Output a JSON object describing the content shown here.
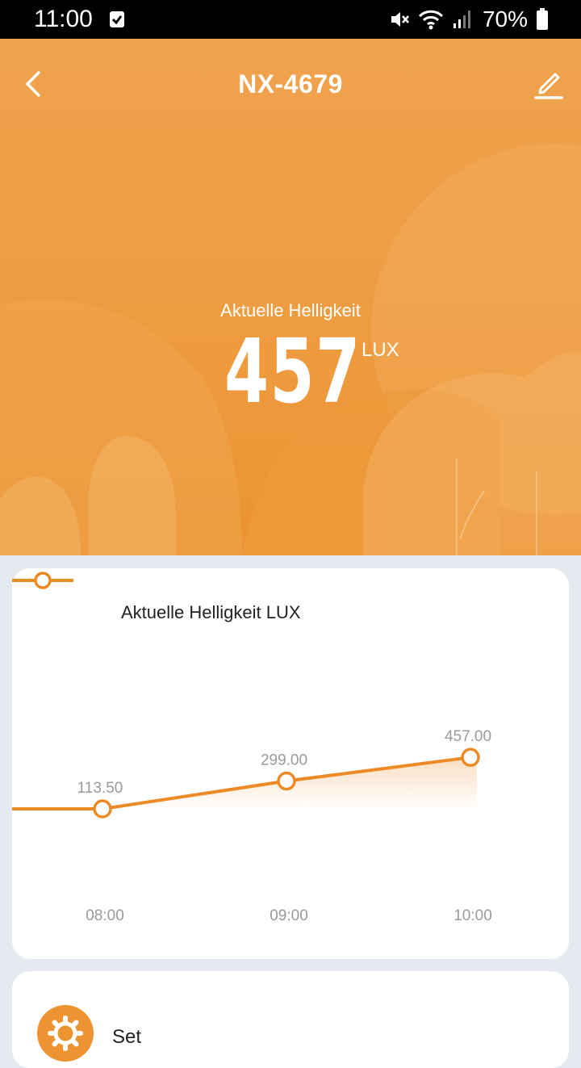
{
  "status_bar": {
    "time": "11:00",
    "battery": "70%"
  },
  "header": {
    "title": "NX-4679",
    "back_icon": "chevron-left-icon",
    "edit_icon": "pencil-icon"
  },
  "reading": {
    "label": "Aktuelle Helligkeit",
    "value": "457",
    "unit": "LUX"
  },
  "chart_data": {
    "type": "line",
    "legend": "Aktuelle Helligkeit LUX",
    "categories": [
      "08:00",
      "09:00",
      "10:00"
    ],
    "series": [
      {
        "name": "Aktuelle Helligkeit LUX",
        "values": [
          113.5,
          299.0,
          457.0
        ],
        "labels": [
          "113.50",
          "299.00",
          "457.00"
        ]
      }
    ],
    "color": "#ec8a26",
    "ylim": [
      0,
      500
    ]
  },
  "settings": {
    "label": "Set",
    "icon": "gear-icon"
  }
}
